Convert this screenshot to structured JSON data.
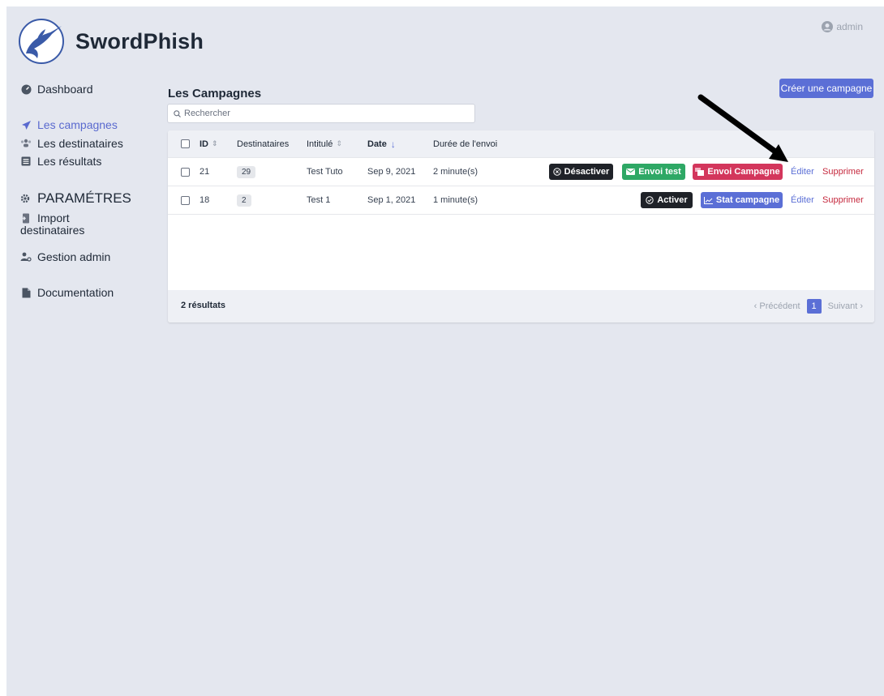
{
  "app": {
    "name": "SwordPhish",
    "user": "admin"
  },
  "sidebar": {
    "dashboard": "Dashboard",
    "campaigns": "Les campagnes",
    "recipients": "Les destinataires",
    "results": "Les résultats",
    "settings_header": "PARAMÉTRES",
    "import_line1": "Import",
    "import_line2": "destinataires",
    "admin": "Gestion admin",
    "docs": "Documentation"
  },
  "main": {
    "title": "Les Campagnes",
    "create_button": "Créer une campagne",
    "search_placeholder": "Rechercher",
    "columns": {
      "id": "ID",
      "recipients": "Destinataires",
      "name": "Intitulé",
      "date": "Date",
      "duration": "Durée de l'envoi"
    },
    "rows": [
      {
        "id": "21",
        "recipients": "29",
        "name": "Test Tuto",
        "date": "Sep 9, 2021",
        "duration": "2 minute(s)",
        "toggle_label": "Désactiver",
        "test_label": "Envoi test",
        "send_label": "Envoi Campagne",
        "edit_label": "Éditer",
        "delete_label": "Supprimer"
      },
      {
        "id": "18",
        "recipients": "2",
        "name": "Test 1",
        "date": "Sep 1, 2021",
        "duration": "1 minute(s)",
        "toggle_label": "Activer",
        "stat_label": "Stat campagne",
        "edit_label": "Éditer",
        "delete_label": "Supprimer"
      }
    ],
    "footer": {
      "count": "2 résultats",
      "prev": "Précédent",
      "page": "1",
      "next": "Suivant"
    }
  },
  "colors": {
    "accent": "#5b6fd6",
    "success": "#2ea865",
    "danger": "#d3365c",
    "dark": "#1f2228",
    "link_delete": "#c5283d"
  }
}
